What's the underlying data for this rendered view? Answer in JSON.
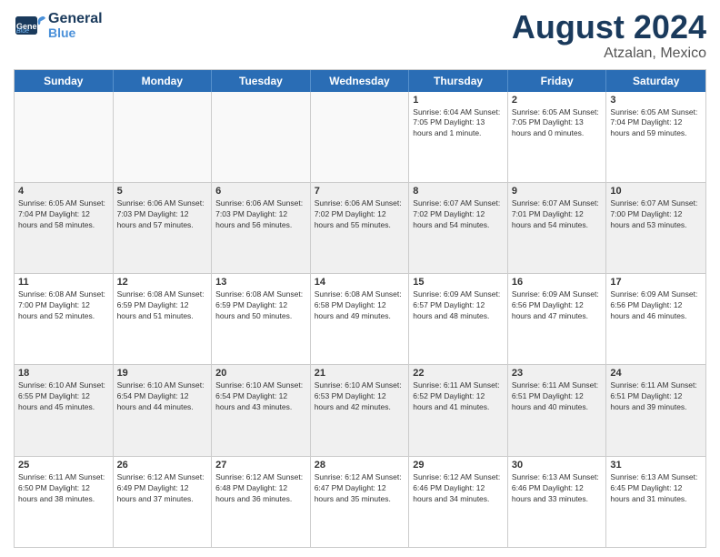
{
  "header": {
    "logo_line1": "General",
    "logo_line2": "Blue",
    "month": "August 2024",
    "location": "Atzalan, Mexico"
  },
  "day_headers": [
    "Sunday",
    "Monday",
    "Tuesday",
    "Wednesday",
    "Thursday",
    "Friday",
    "Saturday"
  ],
  "weeks": [
    [
      {
        "day": "",
        "info": "",
        "empty": true
      },
      {
        "day": "",
        "info": "",
        "empty": true
      },
      {
        "day": "",
        "info": "",
        "empty": true
      },
      {
        "day": "",
        "info": "",
        "empty": true
      },
      {
        "day": "1",
        "info": "Sunrise: 6:04 AM\nSunset: 7:05 PM\nDaylight: 13 hours\nand 1 minute.",
        "empty": false
      },
      {
        "day": "2",
        "info": "Sunrise: 6:05 AM\nSunset: 7:05 PM\nDaylight: 13 hours\nand 0 minutes.",
        "empty": false
      },
      {
        "day": "3",
        "info": "Sunrise: 6:05 AM\nSunset: 7:04 PM\nDaylight: 12 hours\nand 59 minutes.",
        "empty": false
      }
    ],
    [
      {
        "day": "4",
        "info": "Sunrise: 6:05 AM\nSunset: 7:04 PM\nDaylight: 12 hours\nand 58 minutes.",
        "empty": false
      },
      {
        "day": "5",
        "info": "Sunrise: 6:06 AM\nSunset: 7:03 PM\nDaylight: 12 hours\nand 57 minutes.",
        "empty": false
      },
      {
        "day": "6",
        "info": "Sunrise: 6:06 AM\nSunset: 7:03 PM\nDaylight: 12 hours\nand 56 minutes.",
        "empty": false
      },
      {
        "day": "7",
        "info": "Sunrise: 6:06 AM\nSunset: 7:02 PM\nDaylight: 12 hours\nand 55 minutes.",
        "empty": false
      },
      {
        "day": "8",
        "info": "Sunrise: 6:07 AM\nSunset: 7:02 PM\nDaylight: 12 hours\nand 54 minutes.",
        "empty": false
      },
      {
        "day": "9",
        "info": "Sunrise: 6:07 AM\nSunset: 7:01 PM\nDaylight: 12 hours\nand 54 minutes.",
        "empty": false
      },
      {
        "day": "10",
        "info": "Sunrise: 6:07 AM\nSunset: 7:00 PM\nDaylight: 12 hours\nand 53 minutes.",
        "empty": false
      }
    ],
    [
      {
        "day": "11",
        "info": "Sunrise: 6:08 AM\nSunset: 7:00 PM\nDaylight: 12 hours\nand 52 minutes.",
        "empty": false
      },
      {
        "day": "12",
        "info": "Sunrise: 6:08 AM\nSunset: 6:59 PM\nDaylight: 12 hours\nand 51 minutes.",
        "empty": false
      },
      {
        "day": "13",
        "info": "Sunrise: 6:08 AM\nSunset: 6:59 PM\nDaylight: 12 hours\nand 50 minutes.",
        "empty": false
      },
      {
        "day": "14",
        "info": "Sunrise: 6:08 AM\nSunset: 6:58 PM\nDaylight: 12 hours\nand 49 minutes.",
        "empty": false
      },
      {
        "day": "15",
        "info": "Sunrise: 6:09 AM\nSunset: 6:57 PM\nDaylight: 12 hours\nand 48 minutes.",
        "empty": false
      },
      {
        "day": "16",
        "info": "Sunrise: 6:09 AM\nSunset: 6:56 PM\nDaylight: 12 hours\nand 47 minutes.",
        "empty": false
      },
      {
        "day": "17",
        "info": "Sunrise: 6:09 AM\nSunset: 6:56 PM\nDaylight: 12 hours\nand 46 minutes.",
        "empty": false
      }
    ],
    [
      {
        "day": "18",
        "info": "Sunrise: 6:10 AM\nSunset: 6:55 PM\nDaylight: 12 hours\nand 45 minutes.",
        "empty": false
      },
      {
        "day": "19",
        "info": "Sunrise: 6:10 AM\nSunset: 6:54 PM\nDaylight: 12 hours\nand 44 minutes.",
        "empty": false
      },
      {
        "day": "20",
        "info": "Sunrise: 6:10 AM\nSunset: 6:54 PM\nDaylight: 12 hours\nand 43 minutes.",
        "empty": false
      },
      {
        "day": "21",
        "info": "Sunrise: 6:10 AM\nSunset: 6:53 PM\nDaylight: 12 hours\nand 42 minutes.",
        "empty": false
      },
      {
        "day": "22",
        "info": "Sunrise: 6:11 AM\nSunset: 6:52 PM\nDaylight: 12 hours\nand 41 minutes.",
        "empty": false
      },
      {
        "day": "23",
        "info": "Sunrise: 6:11 AM\nSunset: 6:51 PM\nDaylight: 12 hours\nand 40 minutes.",
        "empty": false
      },
      {
        "day": "24",
        "info": "Sunrise: 6:11 AM\nSunset: 6:51 PM\nDaylight: 12 hours\nand 39 minutes.",
        "empty": false
      }
    ],
    [
      {
        "day": "25",
        "info": "Sunrise: 6:11 AM\nSunset: 6:50 PM\nDaylight: 12 hours\nand 38 minutes.",
        "empty": false
      },
      {
        "day": "26",
        "info": "Sunrise: 6:12 AM\nSunset: 6:49 PM\nDaylight: 12 hours\nand 37 minutes.",
        "empty": false
      },
      {
        "day": "27",
        "info": "Sunrise: 6:12 AM\nSunset: 6:48 PM\nDaylight: 12 hours\nand 36 minutes.",
        "empty": false
      },
      {
        "day": "28",
        "info": "Sunrise: 6:12 AM\nSunset: 6:47 PM\nDaylight: 12 hours\nand 35 minutes.",
        "empty": false
      },
      {
        "day": "29",
        "info": "Sunrise: 6:12 AM\nSunset: 6:46 PM\nDaylight: 12 hours\nand 34 minutes.",
        "empty": false
      },
      {
        "day": "30",
        "info": "Sunrise: 6:13 AM\nSunset: 6:46 PM\nDaylight: 12 hours\nand 33 minutes.",
        "empty": false
      },
      {
        "day": "31",
        "info": "Sunrise: 6:13 AM\nSunset: 6:45 PM\nDaylight: 12 hours\nand 31 minutes.",
        "empty": false
      }
    ]
  ]
}
